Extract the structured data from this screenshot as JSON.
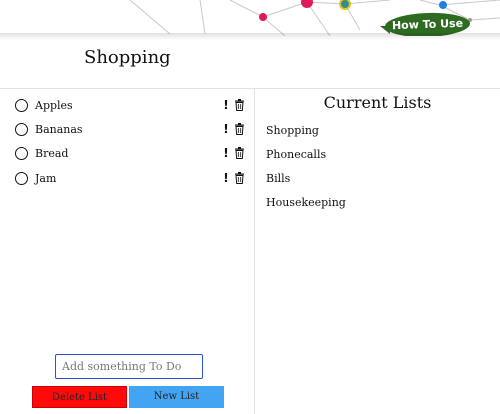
{
  "header": {
    "how_to_use_label": "How To Use"
  },
  "list": {
    "title": "Shopping"
  },
  "todos": [
    {
      "label": "Apples",
      "priority_icon": "exclamation-icon",
      "delete_icon": "trash-icon"
    },
    {
      "label": "Bananas",
      "priority_icon": "exclamation-icon",
      "delete_icon": "trash-icon"
    },
    {
      "label": "Bread",
      "priority_icon": "exclamation-icon",
      "delete_icon": "trash-icon"
    },
    {
      "label": "Jam",
      "priority_icon": "exclamation-icon",
      "delete_icon": "trash-icon"
    }
  ],
  "priority_mark": "!",
  "add_todo": {
    "placeholder": "Add something To Do",
    "value": ""
  },
  "buttons": {
    "delete_list": "Delete List",
    "new_list": "New List"
  },
  "current_lists": {
    "title": "Current Lists",
    "items": [
      "Shopping",
      "Phonecalls",
      "Bills",
      "Housekeeping"
    ]
  },
  "colors": {
    "delete_button": "#ff0a0a",
    "new_button": "#43a4f3",
    "how_to_badge": "#2e6a22",
    "input_focus_border": "#2b4fd6"
  }
}
